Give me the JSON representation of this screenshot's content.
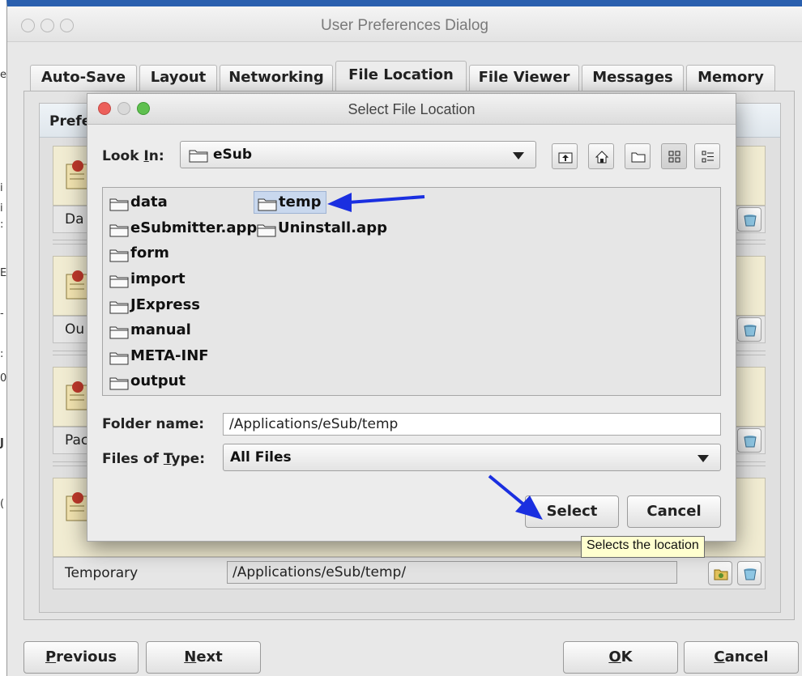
{
  "outer_window": {
    "title": "User Preferences Dialog",
    "tabs": [
      {
        "label": "Auto-Save"
      },
      {
        "label": "Layout"
      },
      {
        "label": "Networking"
      },
      {
        "label": "File Location"
      },
      {
        "label": "File Viewer"
      },
      {
        "label": "Messages"
      },
      {
        "label": "Memory"
      }
    ],
    "active_tab": "File Location",
    "panel_header_partial": "Prefe",
    "rows": {
      "row1_label_partial": "Da",
      "row2_label_partial": "Ou",
      "row3_label_partial": "Pac",
      "temporary": {
        "label": "Temporary",
        "path": "/Applications/eSub/temp/"
      }
    },
    "buttons": {
      "previous_first": "P",
      "previous_rest": "revious",
      "next_first": "N",
      "next_rest": "ext",
      "ok_first": "O",
      "ok_rest": "K",
      "cancel_first": "C",
      "cancel_rest": "ancel"
    }
  },
  "dialog": {
    "title": "Select File Location",
    "look_in": {
      "label_pre": "Look ",
      "label_mnemonic": "I",
      "label_post": "n:",
      "value": "eSub"
    },
    "toolbar_icons": [
      "up-folder-icon",
      "home-icon",
      "new-folder-icon",
      "list-view-icon",
      "details-view-icon"
    ],
    "files": [
      {
        "name": "data"
      },
      {
        "name": "eSubmitter.app"
      },
      {
        "name": "form"
      },
      {
        "name": "import"
      },
      {
        "name": "JExpress"
      },
      {
        "name": "manual"
      },
      {
        "name": "META-INF"
      },
      {
        "name": "output"
      },
      {
        "name": "temp",
        "selected": true
      },
      {
        "name": "Uninstall.app"
      }
    ],
    "folder_name": {
      "label": "Folder name:",
      "value": "/Applications/eSub/temp"
    },
    "files_of_type": {
      "label_pre": "Files of ",
      "label_mnemonic": "T",
      "label_post": "ype:",
      "value": "All Files"
    },
    "select_label": "Select",
    "cancel_label": "Cancel",
    "tooltip": "Selects the location"
  },
  "colors": {
    "arrow": "#1a2fe0",
    "selection": "#c9d8ee",
    "tooltip_bg": "#ffffcf",
    "close_light": "#ec5f5a",
    "minimize_light": "#d4d4d4",
    "zoom_light": "#5fc04f"
  }
}
